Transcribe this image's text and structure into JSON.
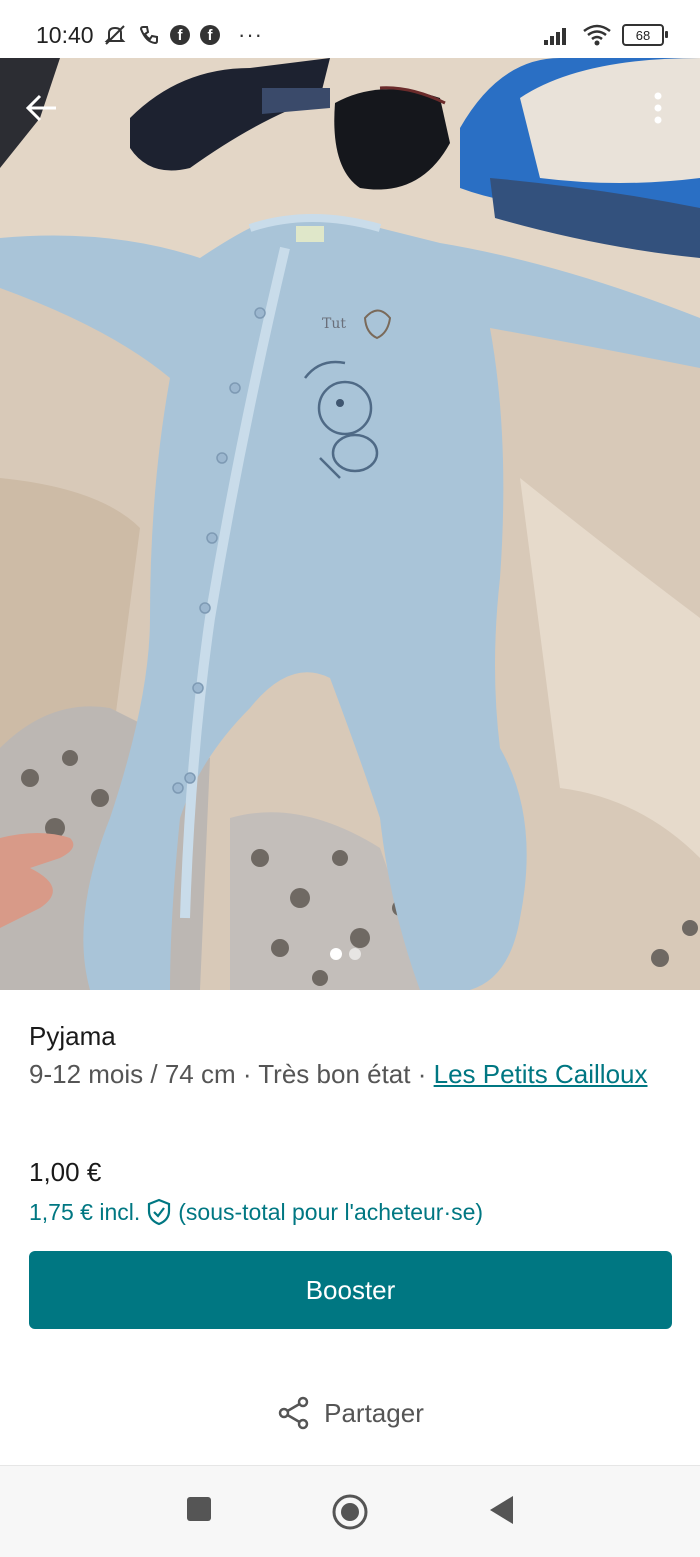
{
  "status_bar": {
    "time": "10:40",
    "more": "···",
    "battery": "68",
    "facebook_glyph": "f"
  },
  "photo": {
    "dots": 2,
    "active_dot": 0,
    "icons": [
      "back-arrow-icon",
      "more-vertical-icon"
    ]
  },
  "item": {
    "title": "Pyjama",
    "details": "9-12 mois / 74 cm · Très bon état · ",
    "brand": "Les Petits Cailloux",
    "price": "1,00 €",
    "price_incl": "1,75 € incl.",
    "price_note": "(sous-total pour l'acheteur·se)"
  },
  "actions": {
    "booster_label": "Booster",
    "share_label": "Partager"
  },
  "colors": {
    "accent": "#007782"
  }
}
